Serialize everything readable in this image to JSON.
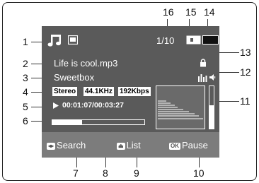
{
  "status": {
    "file_counter": "1/10"
  },
  "track": {
    "filename": "Life is cool.mp3",
    "artist": "Sweetbox",
    "mode": "Stereo",
    "sample_rate": "44.1KHz",
    "bitrate": "192Kbps",
    "time": "00:01:07/00:03:27",
    "progress_fraction": 0.32
  },
  "volume": {
    "level_fraction": 0.55
  },
  "buttons": {
    "search_label": "Search",
    "list_label": "List",
    "ok_key": "OK",
    "pause_label": "Pause"
  },
  "icons": {
    "mode": "music-note-icon",
    "card": "memory-card-icon",
    "battery": "battery-icon",
    "lock": "lock-icon",
    "equalizer": "equalizer-icon",
    "speaker": "speaker-icon",
    "play": "play-icon"
  },
  "callouts": {
    "c1": "1",
    "c2": "2",
    "c3": "3",
    "c4": "4",
    "c5": "5",
    "c6": "6",
    "c7": "7",
    "c8": "8",
    "c9": "9",
    "c10": "10",
    "c11": "11",
    "c12": "12",
    "c13": "13",
    "c14": "14",
    "c15": "15",
    "c16": "16"
  }
}
